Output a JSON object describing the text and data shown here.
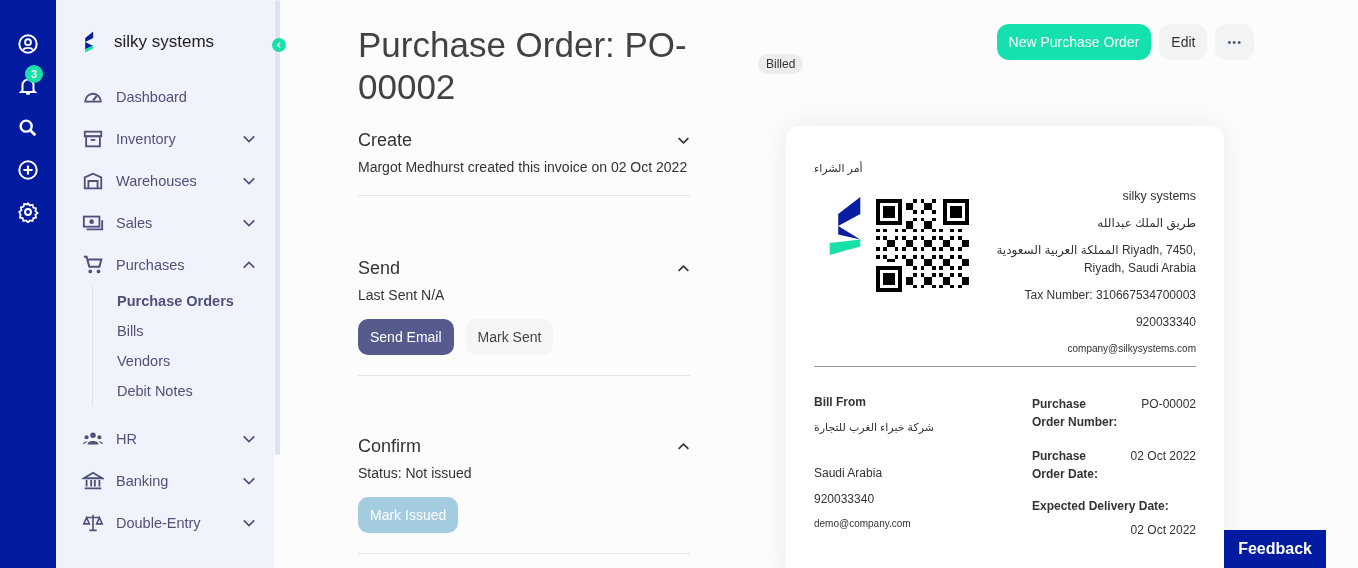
{
  "rail": {
    "notification_count": "3"
  },
  "brand": {
    "name": "silky systems"
  },
  "nav": [
    {
      "label": "Dashboard",
      "kind": "link"
    },
    {
      "label": "Inventory",
      "kind": "group",
      "expanded": false
    },
    {
      "label": "Warehouses",
      "kind": "group",
      "expanded": false
    },
    {
      "label": "Sales",
      "kind": "group",
      "expanded": false
    },
    {
      "label": "Purchases",
      "kind": "group",
      "expanded": true,
      "children": [
        {
          "label": "Purchase Orders",
          "selected": true
        },
        {
          "label": "Bills",
          "selected": false
        },
        {
          "label": "Vendors",
          "selected": false
        },
        {
          "label": "Debit Notes",
          "selected": false
        }
      ]
    },
    {
      "label": "HR",
      "kind": "group",
      "expanded": false
    },
    {
      "label": "Banking",
      "kind": "group",
      "expanded": false
    },
    {
      "label": "Double-Entry",
      "kind": "group",
      "expanded": false
    }
  ],
  "header": {
    "title": "Purchase Order: PO-00002",
    "status": "Billed",
    "actions": [
      {
        "label": "New Purchase Order",
        "kind": "primary"
      },
      {
        "label": "Edit",
        "kind": "secondary"
      },
      {
        "label": "•••",
        "kind": "more"
      }
    ]
  },
  "sections": [
    {
      "title": "Create",
      "expanded": false,
      "text": "Margot Medhurst created this invoice on 02 Oct 2022"
    },
    {
      "title": "Send",
      "expanded": true,
      "text": "Last Sent N/A",
      "buttons": [
        {
          "label": "Send Email",
          "kind": "primary",
          "disabled": false
        },
        {
          "label": "Mark Sent",
          "kind": "secondary",
          "disabled": false
        }
      ]
    },
    {
      "title": "Confirm",
      "expanded": true,
      "text": "Status: Not issued",
      "buttons": [
        {
          "label": "Mark Issued",
          "kind": "primary",
          "disabled": true
        }
      ]
    }
  ],
  "invoice": {
    "doc_title": "أمر الشراء",
    "company": {
      "name": "silky systems",
      "street": "طريق الملك عبدالله",
      "address": "المملكة العربية السعودية Riyadh, 7450, Riyadh, Saudi Arabia",
      "tax": "Tax Number: 310667534700003",
      "phone": "920033340",
      "email": "company@silkysystems.com"
    },
    "bill_from": {
      "heading": "Bill From",
      "name": "شركة خبراء الغرب للتجارة",
      "country": "Saudi Arabia",
      "phone": "920033340",
      "email": "demo@company.com"
    },
    "meta": [
      {
        "label": "Purchase Order Number:",
        "value": "PO-00002",
        "kind": "inline"
      },
      {
        "label": "Purchase Order Date:",
        "value": "02 Oct 2022",
        "kind": "inline"
      },
      {
        "label": "Expected Delivery Date:",
        "value": "02 Oct 2022",
        "kind": "stacked"
      }
    ]
  },
  "feedback": {
    "label": "Feedback"
  }
}
